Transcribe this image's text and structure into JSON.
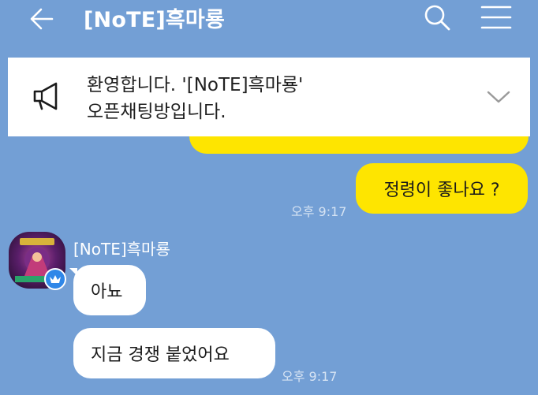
{
  "header": {
    "title": "[NoTE]흑마룡"
  },
  "notice": {
    "line1": "환영합니다. '[NoTE]흑마룡'",
    "line2": "오픈채팅방입니다."
  },
  "messages": {
    "my_message": "정령이 좋나요 ?",
    "my_time": "오후 9:17",
    "sender_name": "[NoTE]흑마룡",
    "reply1": "아뇨",
    "reply2": "지금 경쟁 붙었어요",
    "reply_time": "오후 9:17"
  },
  "colors": {
    "background": "#739fd5",
    "my_bubble": "#fee500",
    "other_bubble": "#ffffff",
    "badge": "#2f87e8"
  }
}
